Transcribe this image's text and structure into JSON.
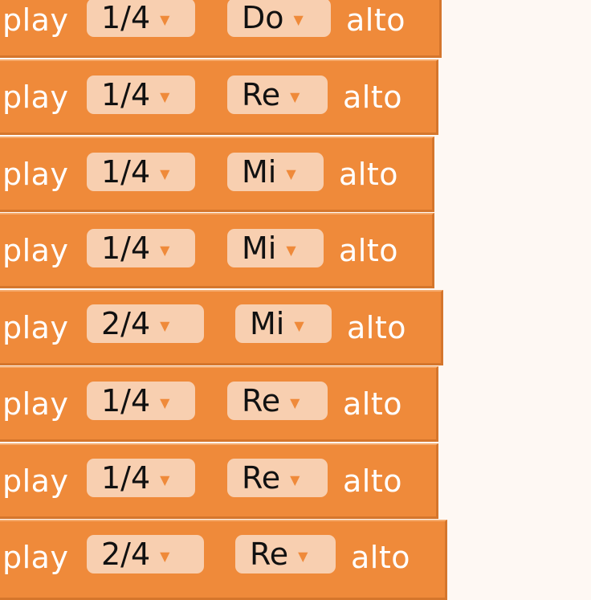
{
  "blocks": [
    {
      "action": "play",
      "duration": "1/4",
      "note": "Do",
      "octave": "alto"
    },
    {
      "action": "play",
      "duration": "1/4",
      "note": "Re",
      "octave": "alto"
    },
    {
      "action": "play",
      "duration": "1/4",
      "note": "Mi",
      "octave": "alto"
    },
    {
      "action": "play",
      "duration": "1/4",
      "note": "Mi",
      "octave": "alto"
    },
    {
      "action": "play",
      "duration": "2/4",
      "note": "Mi",
      "octave": "alto"
    },
    {
      "action": "play",
      "duration": "1/4",
      "note": "Re",
      "octave": "alto"
    },
    {
      "action": "play",
      "duration": "1/4",
      "note": "Re",
      "octave": "alto"
    },
    {
      "action": "play",
      "duration": "2/4",
      "note": "Re",
      "octave": "alto"
    }
  ],
  "icons": {
    "dropdown_caret": "caret-down-icon"
  },
  "colors": {
    "block": "#ef8a3a",
    "block_border": "#d5762c",
    "dropdown": "#f8cfb0",
    "workspace": "#fef8f3",
    "label_text": "#ffffff",
    "dropdown_text": "#111111"
  }
}
